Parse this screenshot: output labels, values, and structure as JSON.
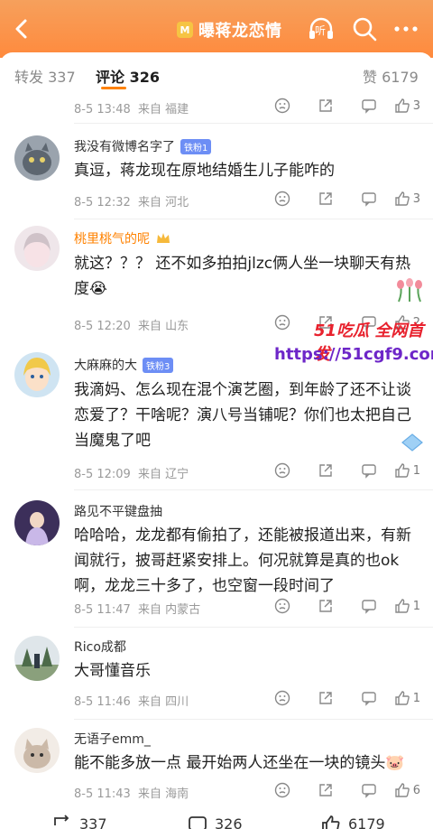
{
  "header": {
    "title": "曝蒋龙恋情",
    "topic_icon_text": "M",
    "listen_label": "听"
  },
  "tabs": [
    {
      "label": "转发",
      "count": "337"
    },
    {
      "label": "评论",
      "count": "326"
    },
    {
      "label": "赞",
      "count": "6179"
    }
  ],
  "prev_meta": {
    "time": "8-5 13:48",
    "source": "来自 福建",
    "likes": "3"
  },
  "comments": [
    {
      "name": "我没有微博名字了",
      "badge": "铁粉1",
      "text": "真逗，蒋龙现在原地结婚生儿子能咋的",
      "time": "8-5 12:32",
      "source": "来自 河北",
      "likes": "3"
    },
    {
      "name": "桃里桃气的呢",
      "badge": "",
      "text": "就这？？？ 还不如多拍拍jlzc俩人坐一块聊天有热度😭",
      "time": "8-5 12:20",
      "source": "来自 山东",
      "likes": "2"
    },
    {
      "name": "大麻麻的大",
      "badge": "铁粉3",
      "text": "我滴妈、怎么现在混个演艺圈，到年龄了还不让谈恋爱了？干啥呢？演八号当铺呢？你们也太把自己当魔鬼了吧",
      "time": "8-5 12:09",
      "source": "来自 辽宁",
      "likes": "1"
    },
    {
      "name": "路见不平键盘抽",
      "badge": "",
      "text": "哈哈哈，龙龙都有偷拍了，还能被报道出来，有新闻就行，披哥赶紧安排上。何况就算是真的也ok啊，龙龙三十多了，也空窗一段时间了",
      "time": "8-5 11:47",
      "source": "来自 内蒙古",
      "likes": "1"
    },
    {
      "name": "Rico成都",
      "badge": "",
      "text": "大哥懂音乐",
      "time": "8-5 11:46",
      "source": "来自 四川",
      "likes": "1"
    },
    {
      "name": "无语子emm_",
      "badge": "",
      "text": "能不能多放一点 最开始两人还坐在一块的镜头🐷",
      "time": "8-5 11:43",
      "source": "来自 海南",
      "likes": "6"
    }
  ],
  "watermark": {
    "brand": "51吃瓜 全网首发",
    "url": "https://51cgf9.com"
  },
  "bottom": {
    "repost": "337",
    "comment": "326",
    "like": "6179"
  },
  "colors": {
    "accent": "#ff8200",
    "header": "#ff8a3d",
    "fan_badge": "#6d8ef5"
  }
}
